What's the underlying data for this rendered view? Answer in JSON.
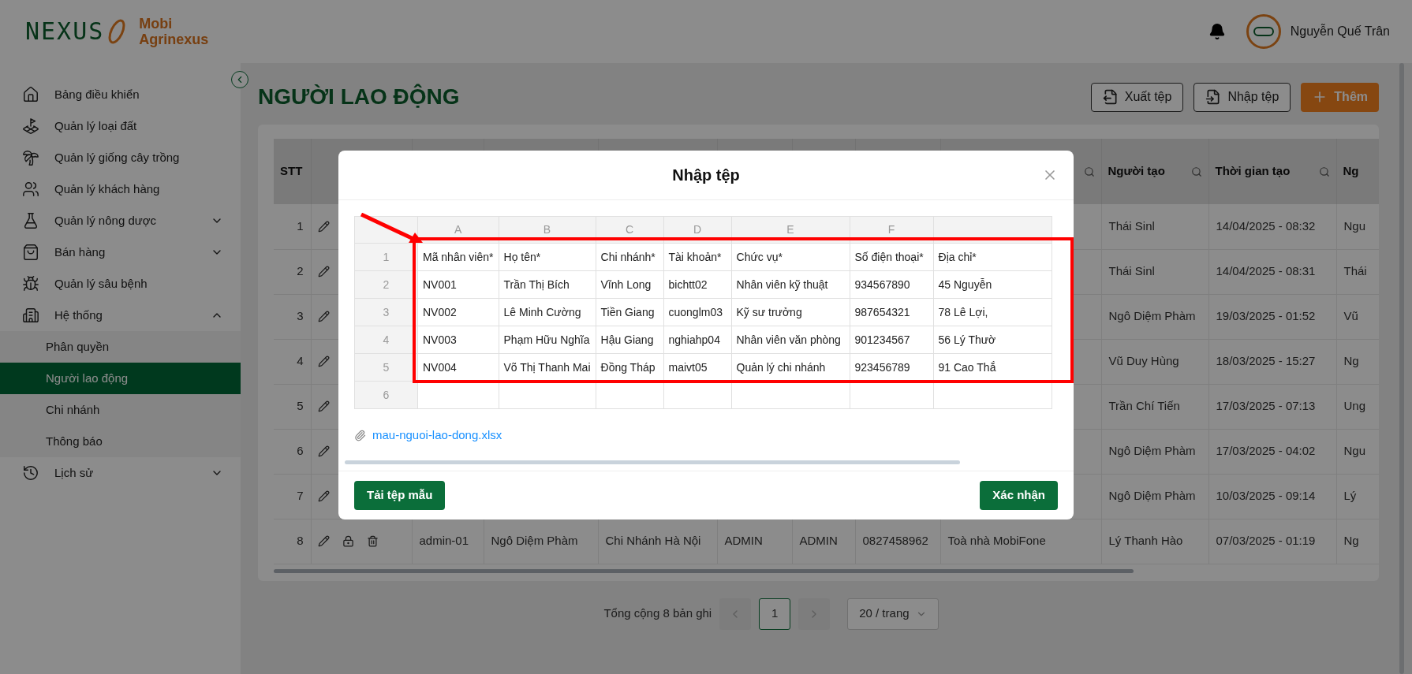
{
  "brand": {
    "logo_text": "NEXUS",
    "name_line_1": "Mobi",
    "name_line_2": "Agrinexus"
  },
  "user": {
    "name": "Nguyễn Quế Trân"
  },
  "sidebar": {
    "items": [
      {
        "label": "Bảng điều khiển",
        "selected": false
      },
      {
        "label": "Quản lý loại đất",
        "selected": false
      },
      {
        "label": "Quản lý giống cây trồng",
        "selected": false
      },
      {
        "label": "Quản lý khách hàng",
        "selected": false
      },
      {
        "label": "Quản lý nông dược",
        "selected": false,
        "expanded": false
      },
      {
        "label": "Bán hàng",
        "selected": false,
        "expanded": false
      },
      {
        "label": "Quản lý sâu bệnh",
        "selected": false
      },
      {
        "label": "Hệ thống",
        "selected": false,
        "expanded": true,
        "children": [
          {
            "label": "Phân quyền",
            "selected": false
          },
          {
            "label": "Người lao động",
            "selected": true
          },
          {
            "label": "Chi nhánh",
            "selected": false
          },
          {
            "label": "Thông báo",
            "selected": false
          }
        ]
      },
      {
        "label": "Lịch sử",
        "selected": false,
        "expanded": false
      }
    ]
  },
  "page": {
    "title": "NGƯỜI LAO ĐỘNG",
    "actions": [
      {
        "label": "Xuất tệp",
        "kind": "export"
      },
      {
        "label": "Nhập tệp",
        "kind": "import"
      },
      {
        "label": "Thêm",
        "kind": "add"
      }
    ]
  },
  "table": {
    "columns": [
      {
        "label": "STT"
      },
      {},
      {},
      {},
      {},
      {},
      {},
      {},
      {
        "searchable": true
      },
      {
        "label": "Người tạo",
        "searchable": true
      },
      {
        "label": "Thời gian tạo",
        "searchable": true
      },
      {
        "label": "Ng"
      }
    ],
    "rows": [
      {
        "cells": [
          "1",
          null,
          null,
          null,
          null,
          null,
          null,
          null,
          null,
          "Thái Sinl",
          "14/04/2025 - 08:32",
          "Ngu"
        ]
      },
      {
        "cells": [
          "2",
          null,
          null,
          null,
          null,
          null,
          null,
          null,
          null,
          "Thái Sinl",
          "14/04/2025 - 08:31",
          "Thái"
        ]
      },
      {
        "cells": [
          "3",
          null,
          null,
          null,
          null,
          null,
          null,
          null,
          null,
          "Ngô Diệm Phàm",
          "19/03/2025 - 01:52",
          "Vũ"
        ]
      },
      {
        "cells": [
          "4",
          null,
          null,
          null,
          null,
          null,
          null,
          null,
          null,
          "Vũ Duy Hùng",
          "18/03/2025 - 15:27",
          "Ng"
        ]
      },
      {
        "cells": [
          "5",
          null,
          null,
          null,
          null,
          null,
          null,
          null,
          null,
          "Trần Chí Tiến",
          "17/03/2025 - 07:13",
          "Ung"
        ]
      },
      {
        "cells": [
          "6",
          null,
          null,
          null,
          null,
          null,
          null,
          null,
          null,
          "Ngô Diệm Phàm",
          "17/03/2025 - 04:02",
          "Ngu"
        ]
      },
      {
        "cells": [
          "7",
          null,
          null,
          null,
          null,
          null,
          null,
          null,
          null,
          "Ngô Diệm Phàm",
          "10/03/2025 - 09:14",
          "Lý"
        ]
      },
      {
        "cells": [
          "8",
          null,
          "admin-01",
          "Ngô Diệm Phàm",
          "Chi Nhánh Hà Nội",
          "ADMIN",
          "ADMIN",
          "0827458962",
          "Toà nhà MobiFone",
          "Lý Thanh Hào",
          "07/03/2025 - 01:19",
          "Ng"
        ]
      }
    ]
  },
  "pagination": {
    "summary": "Tổng cộng 8 bản ghi",
    "prev_disabled": true,
    "pages": [
      {
        "label": "1",
        "selected": true
      }
    ],
    "next_disabled": true,
    "page_size": "20 / trang"
  },
  "modal": {
    "title": "Nhập tệp",
    "sheet": {
      "column_letters": [
        "A",
        "B",
        "C",
        "D",
        "E",
        "F"
      ],
      "rows": [
        {
          "number": "1",
          "cells": [
            "Mã nhân viên*",
            "Họ tên*",
            "Chi nhánh*",
            "Tài khoản*",
            "Chức vụ*",
            "Số điện thoại*",
            "Địa chỉ*"
          ]
        },
        {
          "number": "2",
          "cells": [
            "NV001",
            "Trần Thị Bích",
            "Vĩnh Long",
            "bichtt02",
            "Nhân viên kỹ thuật",
            "934567890",
            "45 Nguyễn"
          ]
        },
        {
          "number": "3",
          "cells": [
            "NV002",
            "Lê Minh Cường",
            "Tiền Giang",
            "cuonglm03",
            "Kỹ sư trưởng",
            "987654321",
            "78 Lê Lợi,"
          ]
        },
        {
          "number": "4",
          "cells": [
            "NV003",
            "Phạm Hữu Nghĩa",
            "Hậu Giang",
            "nghiahp04",
            "Nhân viên văn phòng",
            "901234567",
            "56 Lý Thườ"
          ]
        },
        {
          "number": "5",
          "cells": [
            "NV004",
            "Võ Thị Thanh Mai",
            "Đồng Tháp",
            "maivt05",
            "Quản lý chi nhánh",
            "923456789",
            "91 Cao Thắ"
          ]
        },
        {
          "number": "6"
        }
      ]
    },
    "file": {
      "name": "mau-nguoi-lao-dong.xlsx"
    },
    "buttons": [
      {
        "label": "Tải tệp mẫu"
      },
      {
        "label": "Xác nhận"
      }
    ]
  }
}
